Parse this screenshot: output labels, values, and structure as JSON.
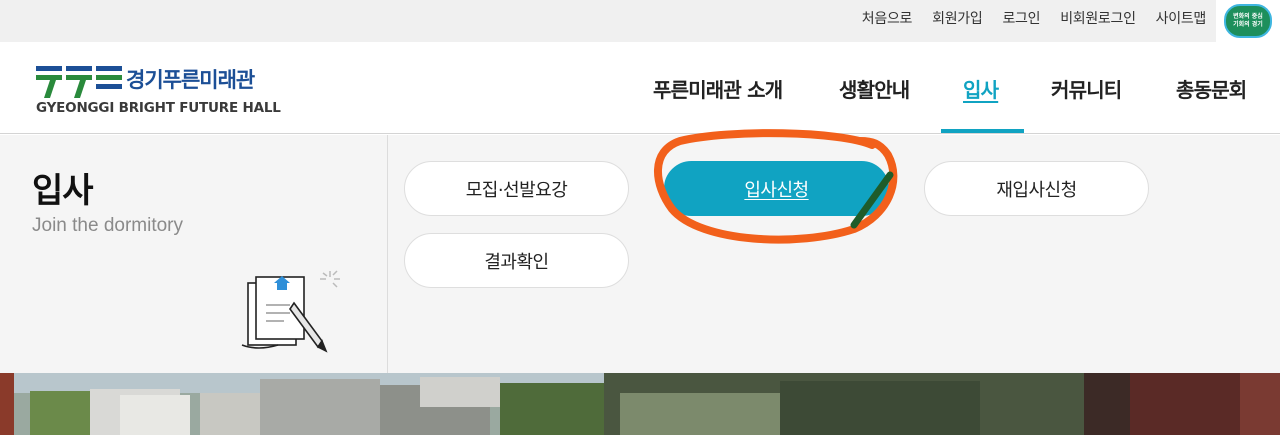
{
  "utility_links": [
    "처음으로",
    "회원가입",
    "로그인",
    "비회원로그인",
    "사이트맵"
  ],
  "badge": {
    "line1": "변화의 중심",
    "line2": "기회의 경기"
  },
  "logo": {
    "korean": "경기푸른미래관",
    "english": "GYEONGGI BRIGHT FUTURE HALL"
  },
  "nav": [
    {
      "label": "푸른미래관 소개",
      "active": false
    },
    {
      "label": "생활안내",
      "active": false
    },
    {
      "label": "입사",
      "active": true
    },
    {
      "label": "커뮤니티",
      "active": false
    },
    {
      "label": "총동문회",
      "active": false
    }
  ],
  "panel": {
    "title": "입사",
    "subtitle": "Join the dormitory",
    "buttons": [
      {
        "label": "모집·선발요강",
        "active": false
      },
      {
        "label": "입사신청",
        "active": true
      },
      {
        "label": "재입사신청",
        "active": false
      },
      {
        "label": "결과확인",
        "active": false
      }
    ]
  },
  "colors": {
    "accent": "#10a3c2",
    "logo_blue": "#1c4f96",
    "logo_green": "#2a8a3c",
    "annotation": "#f2601b"
  }
}
